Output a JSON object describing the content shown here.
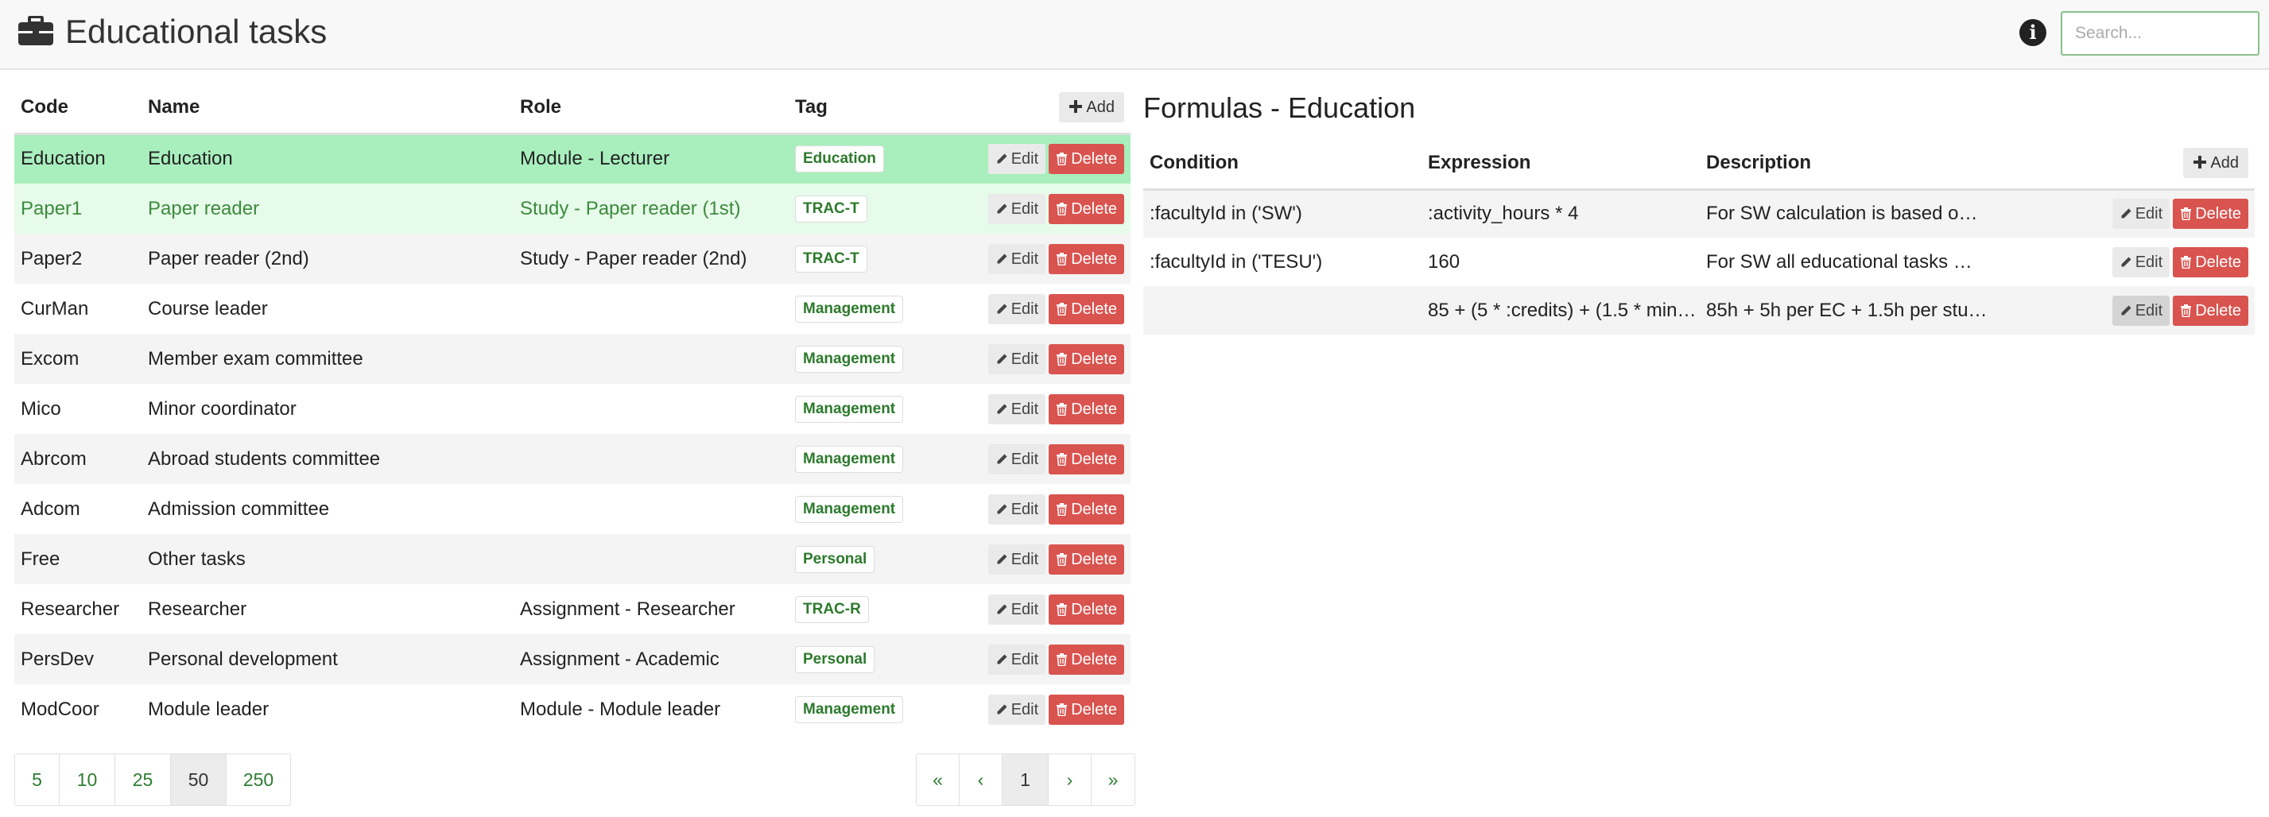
{
  "header": {
    "title": "Educational tasks",
    "search_placeholder": "Search..."
  },
  "tasks_table": {
    "columns": [
      "Code",
      "Name",
      "Role",
      "Tag"
    ],
    "add_label": "Add",
    "edit_label": "Edit",
    "delete_label": "Delete",
    "rows": [
      {
        "code": "Education",
        "name": "Education",
        "role": "Module - Lecturer",
        "tag": "Education",
        "state": "active"
      },
      {
        "code": "Paper1",
        "name": "Paper reader",
        "role": "Study - Paper reader (1st)",
        "tag": "TRAC-T",
        "state": "hover"
      },
      {
        "code": "Paper2",
        "name": "Paper reader (2nd)",
        "role": "Study - Paper reader (2nd)",
        "tag": "TRAC-T",
        "state": ""
      },
      {
        "code": "CurMan",
        "name": "Course leader",
        "role": "",
        "tag": "Management",
        "state": ""
      },
      {
        "code": "Excom",
        "name": "Member exam committee",
        "role": "",
        "tag": "Management",
        "state": ""
      },
      {
        "code": "Mico",
        "name": "Minor coordinator",
        "role": "",
        "tag": "Management",
        "state": ""
      },
      {
        "code": "Abrcom",
        "name": "Abroad students committee",
        "role": "",
        "tag": "Management",
        "state": ""
      },
      {
        "code": "Adcom",
        "name": "Admission committee",
        "role": "",
        "tag": "Management",
        "state": ""
      },
      {
        "code": "Free",
        "name": "Other tasks",
        "role": "",
        "tag": "Personal",
        "state": ""
      },
      {
        "code": "Researcher",
        "name": "Researcher",
        "role": "Assignment - Researcher",
        "tag": "TRAC-R",
        "state": ""
      },
      {
        "code": "PersDev",
        "name": "Personal development",
        "role": "Assignment - Academic",
        "tag": "Personal",
        "state": ""
      },
      {
        "code": "ModCoor",
        "name": "Module leader",
        "role": "Module - Module leader",
        "tag": "Management",
        "state": ""
      }
    ]
  },
  "pagination": {
    "page_sizes": [
      "5",
      "10",
      "25",
      "50",
      "250"
    ],
    "active_page_size": "50",
    "nav": [
      "«",
      "‹",
      "1",
      "›",
      "»"
    ],
    "current_page": "1"
  },
  "formulas": {
    "title": "Formulas - Education",
    "columns": [
      "Condition",
      "Expression",
      "Description"
    ],
    "add_label": "Add",
    "edit_label": "Edit",
    "delete_label": "Delete",
    "rows": [
      {
        "condition": ":facultyId in ('SW')",
        "expression": ":activity_hours * 4",
        "description": "For SW calculation is based o…"
      },
      {
        "condition": ":facultyId in ('TESU')",
        "expression": "160",
        "description": "For SW all educational tasks …"
      },
      {
        "condition": "",
        "expression": "85 + (5 * :credits) + (1.5 * min(…",
        "description": "85h + 5h per EC + 1.5h per stu…"
      }
    ]
  },
  "colors": {
    "active_row": "#a9efbe",
    "hover_row": "#e6fbe9",
    "tag_text": "#2c7a2c",
    "delete_button": "#d9534f",
    "link_green": "#2e7d32"
  }
}
